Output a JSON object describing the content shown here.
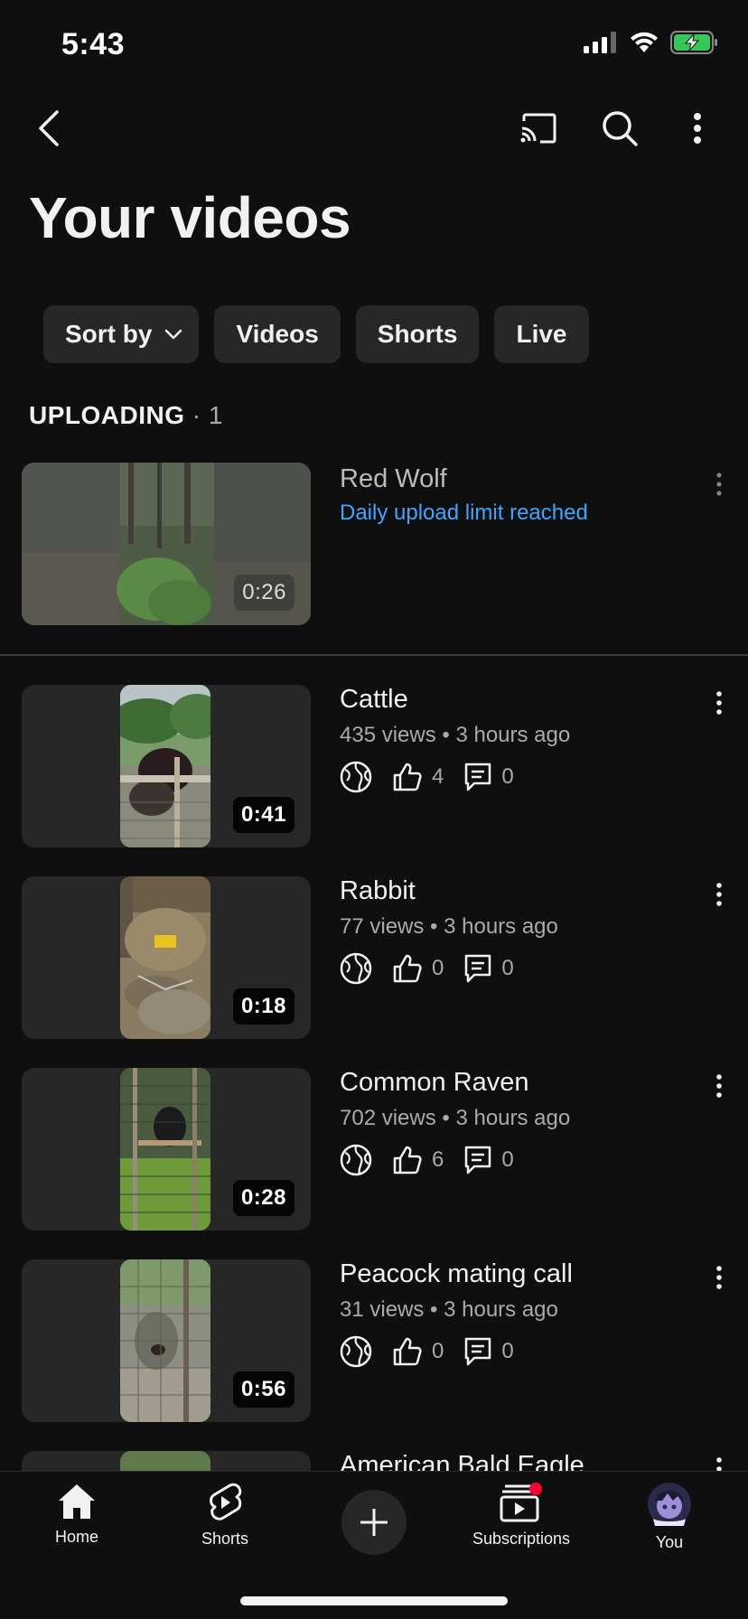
{
  "status_bar": {
    "time": "5:43"
  },
  "page": {
    "title": "Your videos"
  },
  "chips": {
    "sort": "Sort by",
    "videos": "Videos",
    "shorts": "Shorts",
    "live": "Live"
  },
  "section": {
    "label": "UPLOADING",
    "count": "· 1"
  },
  "uploading": {
    "title": "Red Wolf",
    "status": "Daily upload limit reached",
    "duration": "0:26",
    "status_color": "#3ea6ff"
  },
  "videos": [
    {
      "title": "Cattle",
      "meta": "435 views • 3 hours ago",
      "likes": "4",
      "comments": "0",
      "duration": "0:41"
    },
    {
      "title": "Rabbit",
      "meta": "77 views • 3 hours ago",
      "likes": "0",
      "comments": "0",
      "duration": "0:18"
    },
    {
      "title": "Common Raven",
      "meta": "702 views • 3 hours ago",
      "likes": "6",
      "comments": "0",
      "duration": "0:28"
    },
    {
      "title": "Peacock mating call",
      "meta": "31 views • 3 hours ago",
      "likes": "0",
      "comments": "0",
      "duration": "0:56"
    },
    {
      "title": "American Bald Eagle"
    }
  ],
  "nav": {
    "home": "Home",
    "shorts": "Shorts",
    "subscriptions": "Subscriptions",
    "you": "You"
  },
  "icons": {
    "visibility": "globe-icon",
    "likes": "thumbs-up-icon",
    "comments": "comment-icon",
    "cast": "cast-icon",
    "search": "search-icon",
    "more": "more-vert-icon"
  },
  "colors": {
    "background": "#0f0f0f",
    "chip": "#272727",
    "accent_link": "#3ea6ff",
    "notification": "#ff0033",
    "battery": "#34c759"
  }
}
